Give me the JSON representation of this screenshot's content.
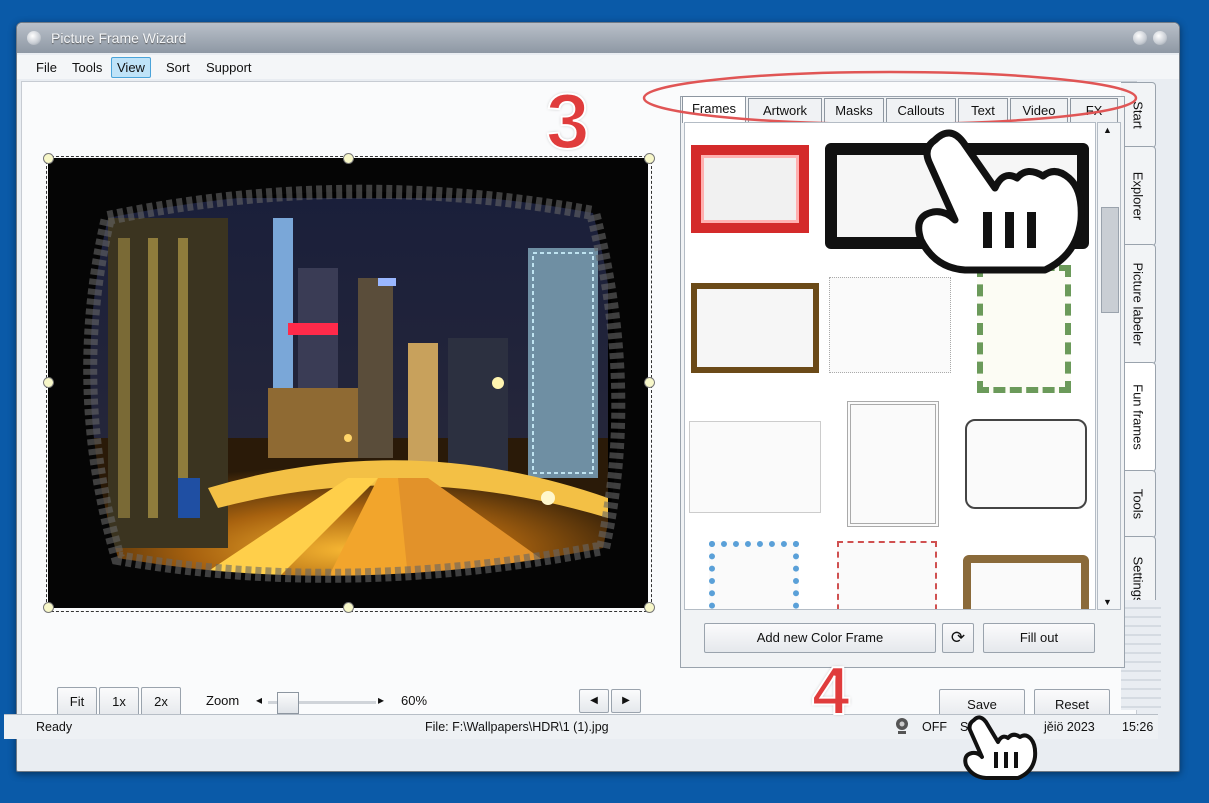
{
  "window": {
    "title": "Picture Frame Wizard"
  },
  "menu": [
    "File",
    "Tools",
    "View",
    "Sort",
    "Support"
  ],
  "menu_active": "View",
  "side_tabs": [
    "Start",
    "Explorer",
    "Picture labeler",
    "Fun frames",
    "Tools",
    "Settings"
  ],
  "frame_tabs": [
    "Frames",
    "Artwork",
    "Masks",
    "Callouts",
    "Text",
    "Video",
    "FX"
  ],
  "frame_tab_selected": "Frames",
  "annotations": {
    "step3": "3",
    "step4": "4"
  },
  "buttons": {
    "add_color_frame": "Add new Color Frame",
    "refresh": "⟳",
    "fill_out": "Fill out",
    "fit": "Fit",
    "one_x": "1x",
    "two_x": "2x",
    "save": "Save",
    "reset": "Reset",
    "prev": "◀",
    "next": "▶"
  },
  "zoom": {
    "label": "Zoom",
    "value_text": "60%",
    "left_arrow": "◂",
    "right_arrow": "▸",
    "level": 0.1
  },
  "status": {
    "ready": "Ready",
    "file": "File: F:\\Wallpapers\\HDR\\1 (1).jpg",
    "toggle": "OFF",
    "s_fragment": "S",
    "date": "jěiö 2023",
    "time": "15:26"
  },
  "icons": {
    "camera": "webcam-icon",
    "refresh": "refresh-icon"
  },
  "colors": {
    "accent": "#e03c3c",
    "desktop": "#0a5aa8"
  }
}
